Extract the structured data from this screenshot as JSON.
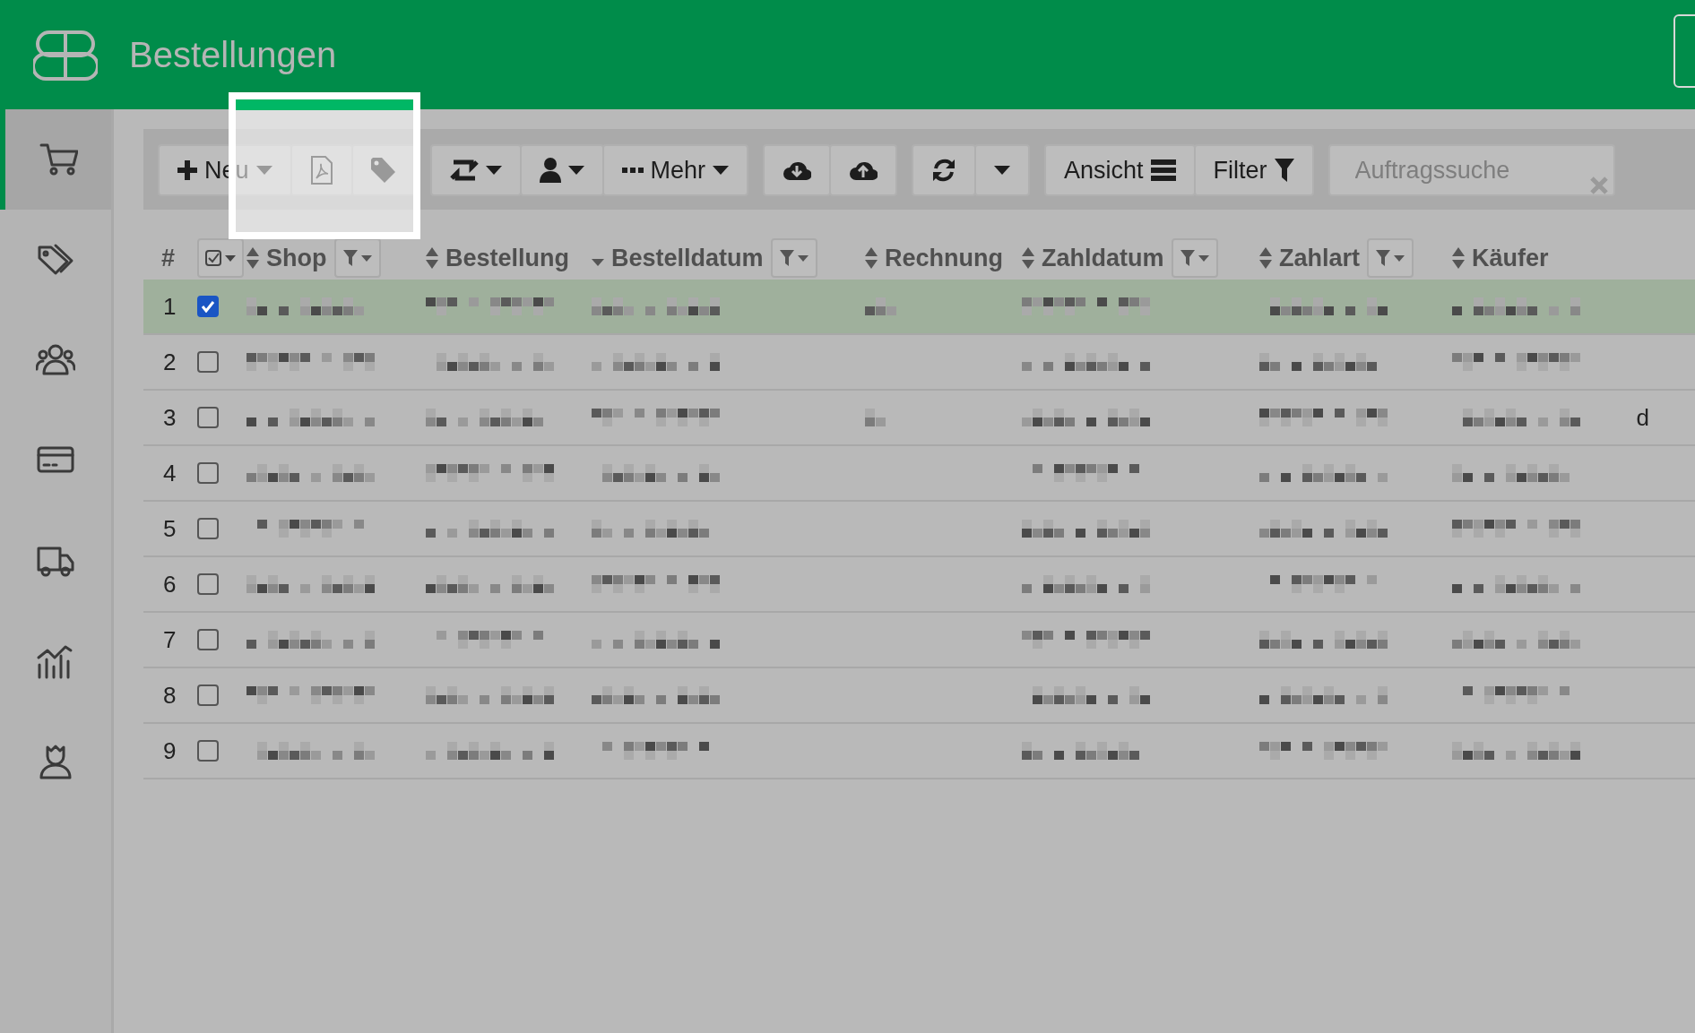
{
  "header": {
    "title": "Bestellungen"
  },
  "sidebar": {
    "items": [
      {
        "kind": "cart",
        "selected": true
      },
      {
        "kind": "tags",
        "selected": false
      },
      {
        "kind": "users",
        "selected": false
      },
      {
        "kind": "card",
        "selected": false
      },
      {
        "kind": "truck",
        "selected": false
      },
      {
        "kind": "chart",
        "selected": false
      },
      {
        "kind": "agent",
        "selected": false
      }
    ]
  },
  "toolbar": {
    "groups": [
      [
        {
          "kind": "new",
          "label": "Neu",
          "caret": true
        },
        {
          "kind": "pdf",
          "caret": false
        },
        {
          "kind": "tag",
          "caret": false
        }
      ],
      [
        {
          "kind": "repeat",
          "caret": true
        },
        {
          "kind": "user",
          "caret": true
        },
        {
          "kind": "more",
          "label": "Mehr",
          "caret": true
        }
      ],
      [
        {
          "kind": "download",
          "caret": false
        },
        {
          "kind": "upload",
          "caret": false
        }
      ],
      [
        {
          "kind": "refresh",
          "caret": false
        },
        {
          "kind": "dropdown",
          "caret": true
        }
      ],
      [
        {
          "kind": "view",
          "label": "Ansicht",
          "caret": false
        },
        {
          "kind": "filter",
          "label": "Filter",
          "caret": false
        }
      ]
    ],
    "search": {
      "placeholder": "Auftragssuche"
    }
  },
  "table": {
    "columns": [
      {
        "label": "#"
      },
      {
        "kind": "select"
      },
      {
        "label": "Shop",
        "sorted_descending": false,
        "filter": true
      },
      {
        "label": "Bestellung",
        "sorted_descending": false,
        "filter": false
      },
      {
        "label": "Bestelldatum",
        "sorted_descending": true,
        "filter": true
      },
      {
        "label": "Rechnung",
        "sorted_descending": false,
        "filter": false
      },
      {
        "label": "Zahldatum",
        "sorted_descending": false,
        "filter": true
      },
      {
        "label": "Zahlart",
        "sorted_descending": false,
        "filter": true
      },
      {
        "label": "Käufer",
        "sorted_descending": false,
        "filter": false
      }
    ],
    "rows": [
      {
        "number": "1",
        "selected": true
      },
      {
        "number": "2",
        "selected": false
      },
      {
        "number": "3",
        "selected": false,
        "overflow": "d"
      },
      {
        "number": "4",
        "selected": false
      },
      {
        "number": "5",
        "selected": false
      },
      {
        "number": "6",
        "selected": false
      },
      {
        "number": "7",
        "selected": false
      },
      {
        "number": "8",
        "selected": false
      },
      {
        "number": "9",
        "selected": false
      }
    ]
  }
}
